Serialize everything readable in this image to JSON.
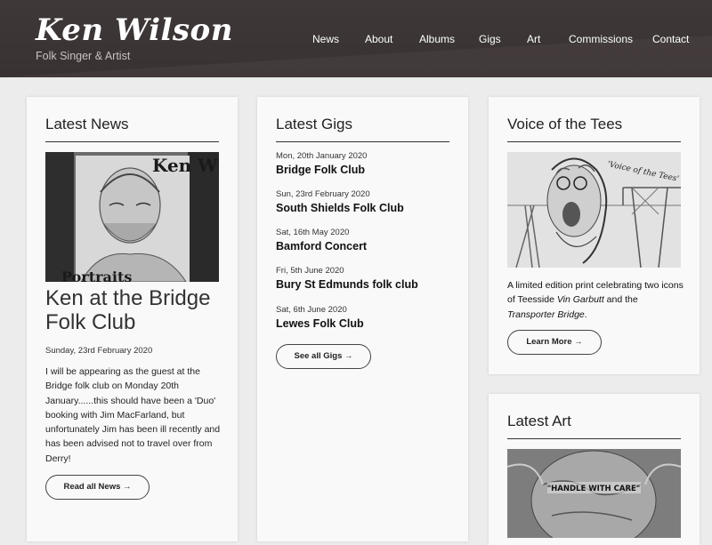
{
  "site": {
    "title": "Ken Wilson",
    "subtitle": "Folk Singer & Artist"
  },
  "nav": {
    "items": [
      {
        "label": "News"
      },
      {
        "label": "About"
      },
      {
        "label": "Albums"
      },
      {
        "label": "Gigs"
      },
      {
        "label": "Art"
      },
      {
        "label": "Commissions"
      },
      {
        "label": "Contact"
      }
    ]
  },
  "news": {
    "heading": "Latest News",
    "image_caption_top": "Ken Wilson",
    "image_caption_bottom": "Portraits",
    "headline": "Ken at the Bridge Folk Club",
    "date": "Sunday, 23rd February 2020",
    "body": "I will be appearing as the guest at the Bridge folk club on Monday 20th January......this should have been a 'Duo' booking with Jim MacFarland, but unfortunately Jim has been ill recently and has been advised not to travel over from Derry!",
    "button": "Read all News →"
  },
  "gigs": {
    "heading": "Latest Gigs",
    "items": [
      {
        "date": "Mon, 20th January 2020",
        "name": "Bridge Folk Club"
      },
      {
        "date": "Sun, 23rd February 2020",
        "name": "South Shields Folk Club"
      },
      {
        "date": "Sat, 16th May 2020",
        "name": "Bamford Concert"
      },
      {
        "date": "Fri, 5th June 2020",
        "name": "Bury St Edmunds folk club"
      },
      {
        "date": "Sat, 6th June 2020",
        "name": "Lewes Folk Club"
      }
    ],
    "button": "See all Gigs →"
  },
  "voice": {
    "heading": "Voice of the Tees",
    "image_caption": "'Voice of the Tees'",
    "body_pre": "A limited edition print celebrating two icons of Teesside ",
    "body_em1": "Vin Garbutt",
    "body_mid": " and the ",
    "body_em2": "Transporter Bridge",
    "body_post": ".",
    "button": "Learn More →"
  },
  "art": {
    "heading": "Latest Art",
    "image_caption": "\"HANDLE WITH CARE\""
  }
}
